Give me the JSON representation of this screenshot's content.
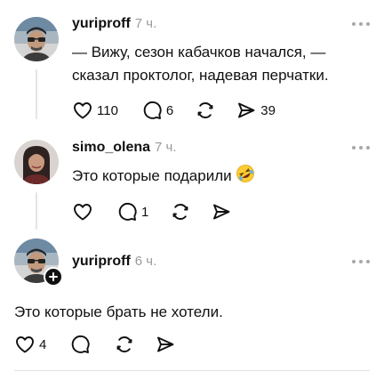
{
  "posts": [
    {
      "username": "yuriproff",
      "time": "7 ч.",
      "text": "— Вижу, сезон кабачков начался, — сказал проктолог, надевая перчатки.",
      "likes": "110",
      "replies": "6",
      "reposts": "",
      "shares": "39"
    },
    {
      "username": "simo_olena",
      "time": "7 ч.",
      "text": "Это которые подарили",
      "emoji": "rolling-on-floor-laughing",
      "likes": "",
      "replies": "1",
      "reposts": "",
      "shares": ""
    },
    {
      "username": "yuriproff",
      "time": "6 ч.",
      "text": "Это которые брать не хотели.",
      "likes": "4",
      "replies": "",
      "reposts": "",
      "shares": ""
    }
  ],
  "icons": {
    "like": "heart-icon",
    "reply": "comment-bubble-icon",
    "repost": "repost-arrows-icon",
    "share": "send-icon",
    "more": "ellipsis-icon",
    "follow": "plus-icon"
  },
  "colors": {
    "text": "#101010",
    "muted": "#9a9a9a",
    "line": "#e4e4e4"
  }
}
